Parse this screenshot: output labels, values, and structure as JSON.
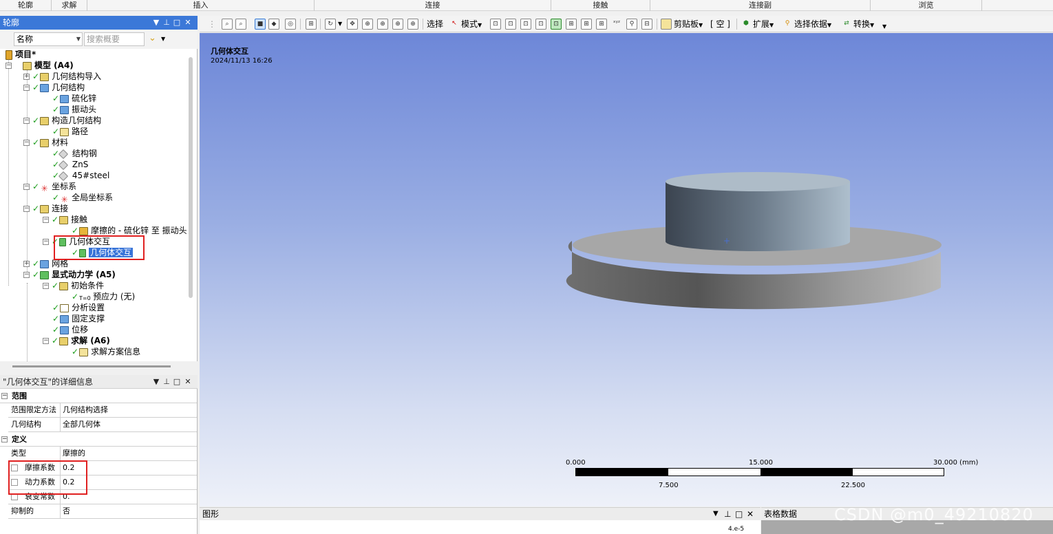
{
  "ribbon_groups": [
    "轮廓",
    "求解",
    "插入",
    "连接",
    "接触",
    "连接副",
    "浏览"
  ],
  "outline": {
    "title": "轮廓",
    "filter_name": "名称",
    "search_placeholder": "搜索概要",
    "tree": [
      {
        "label": "项目*"
      },
      {
        "label": "模型 (A4)"
      },
      {
        "label": "几何结构导入"
      },
      {
        "label": "几何结构"
      },
      {
        "label": "硫化锌"
      },
      {
        "label": "振动头"
      },
      {
        "label": "构造几何结构"
      },
      {
        "label": "路径"
      },
      {
        "label": "材料"
      },
      {
        "label": "结构钢"
      },
      {
        "label": "ZnS"
      },
      {
        "label": "45#steel"
      },
      {
        "label": "坐标系"
      },
      {
        "label": "全局坐标系"
      },
      {
        "label": "连接"
      },
      {
        "label": "接触"
      },
      {
        "label": "摩擦的 - 硫化锌 至 振动头"
      },
      {
        "label": "几何体交互"
      },
      {
        "label": "几何体交互"
      },
      {
        "label": "网格"
      },
      {
        "label": "显式动力学 (A5)"
      },
      {
        "label": "初始条件"
      },
      {
        "label": "预应力 (无)"
      },
      {
        "label": "分析设置"
      },
      {
        "label": "固定支撑"
      },
      {
        "label": "位移"
      },
      {
        "label": "求解 (A6)"
      },
      {
        "label": "求解方案信息"
      }
    ]
  },
  "details": {
    "title": "\"几何体交互\"的详细信息",
    "sections": [
      {
        "label": "范围",
        "rows": [
          {
            "key": "范围限定方法",
            "value": "几何结构选择"
          },
          {
            "key": "几何结构",
            "value": "全部几何体"
          }
        ]
      },
      {
        "label": "定义",
        "rows": [
          {
            "key": "类型",
            "value": "摩擦的"
          },
          {
            "key": "摩擦系数",
            "value": "0.2"
          },
          {
            "key": "动力系数",
            "value": "0.2"
          },
          {
            "key": "衰变常数",
            "value": "0."
          },
          {
            "key": "抑制的",
            "value": "否"
          }
        ]
      }
    ]
  },
  "toolbar": {
    "select_label": "选择",
    "mode_label": "模式",
    "clipboard_label": "剪贴板",
    "empty_label": "[ 空 ]",
    "extend_label": "扩展",
    "select_by_label": "选择依据",
    "convert_label": "转换"
  },
  "viewport": {
    "title": "几何体交互",
    "date": "2024/11/13 16:26",
    "scale": {
      "top_labels": [
        "0.000",
        "15.000",
        "30.000 (mm)"
      ],
      "bottom_labels": [
        "7.500",
        "22.500"
      ]
    }
  },
  "bottom": {
    "graph_title": "图形",
    "graph_axis_value": "4.e-5",
    "table_title": "表格数据"
  },
  "watermark": "CSDN @m0_49210820",
  "colors": {
    "title_bar": "#3b78d8",
    "check": "#1a9c1a",
    "highlight_box": "#e02020",
    "viewport_top": "#6d87d8",
    "viewport_bottom": "#eef1f9"
  }
}
